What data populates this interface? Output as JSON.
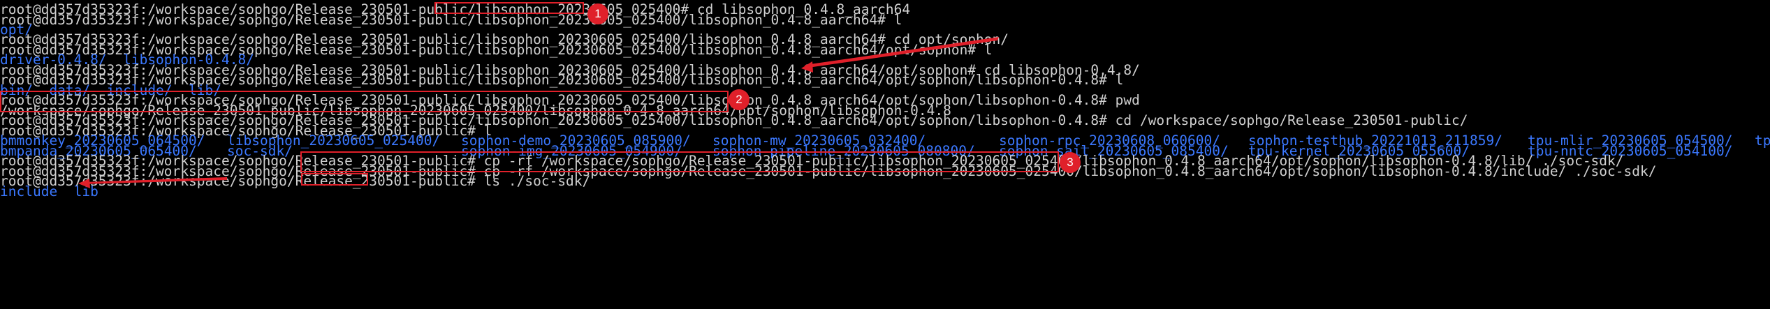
{
  "terminal": {
    "lines": [
      "root@dd357d35323f:/workspace/sophgo/Release_230501-public/libsophon_20230605_025400# cd libsophon_0.4.8_aarch64",
      "root@dd357d35323f:/workspace/sophgo/Release_230501-public/libsophon_20230605_025400/libsophon_0.4.8_aarch64# l",
      "opt/",
      "root@dd357d35323f:/workspace/sophgo/Release_230501-public/libsophon_20230605_025400/libsophon_0.4.8_aarch64# cd opt/sophon/",
      "root@dd357d35323f:/workspace/sophgo/Release_230501-public/libsophon_20230605_025400/libsophon_0.4.8_aarch64/opt/sophon# l",
      "driver-0.4.8/  libsophon-0.4.8/",
      "root@dd357d35323f:/workspace/sophgo/Release_230501-public/libsophon_20230605_025400/libsophon_0.4.8_aarch64/opt/sophon# cd libsophon-0.4.8/",
      "root@dd357d35323f:/workspace/sophgo/Release_230501-public/libsophon_20230605_025400/libsophon_0.4.8_aarch64/opt/sophon/libsophon-0.4.8# l",
      "bin/  data/  include/  lib/",
      "root@dd357d35323f:/workspace/sophgo/Release_230501-public/libsophon_20230605_025400/libsophon_0.4.8_aarch64/opt/sophon/libsophon-0.4.8# pwd",
      "/workspace/sophgo/Release_230501-public/libsophon_20230605_025400/libsophon_0.4.8_aarch64/opt/sophon/libsophon-0.4.8",
      "root@dd357d35323f:/workspace/sophgo/Release_230501-public/libsophon_20230605_025400/libsophon_0.4.8_aarch64/opt/sophon/libsophon-0.4.8# cd /workspace/sophgo/Release_230501-public/",
      "root@dd357d35323f:/workspace/sophgo/Release_230501-public# l",
      "",
      "",
      "root@dd357d35323f:/workspace/sophgo/Release_230501-public# cp -rf /workspace/sophgo/Release_230501-public/libsophon_20230605_025400/libsophon_0.4.8_aarch64/opt/sophon/libsophon-0.4.8/lib/ ./soc-sdk/",
      "root@dd357d35323f:/workspace/sophgo/Release_230501-public# cp -rf /workspace/sophgo/Release_230501-public/libsophon_20230605_025400/libsophon_0.4.8_aarch64/opt/sophon/libsophon-0.4.8/include/ ./soc-sdk/",
      "root@dd357d35323f:/workspace/sophgo/Release_230501-public# ls ./soc-sdk/",
      "include  lib"
    ],
    "ls_rows": [
      [
        "bmmonkey_20230605_064500/",
        "libsophon_20230605_025400/",
        "sophon-demo_20230605_085900/",
        "sophon-mw_20230605_032400/",
        "sophon-rpc_20230608_060600/",
        "sophon-testhub_20221013_211859/",
        "tpu-mlir_20230605_054500/",
        "tp"
      ],
      [
        "bmpanda_20230605_065400/",
        "soc-sdk/",
        "sophon-img_20230605_054900/",
        "sophon-pipeline_20230605_080800/",
        "sophon-sail_20230605_085400/",
        "tpu-kernel_20230605_055600/",
        "tpu-nntc_20230605_054100/",
        ""
      ]
    ]
  },
  "annotations": {
    "badge_1": "1",
    "badge_2": "2",
    "badge_3": "3"
  },
  "colors": {
    "background": "#000000",
    "text": "#d0d0d0",
    "directory": "#3b78ff",
    "annotation": "#e0202a"
  }
}
